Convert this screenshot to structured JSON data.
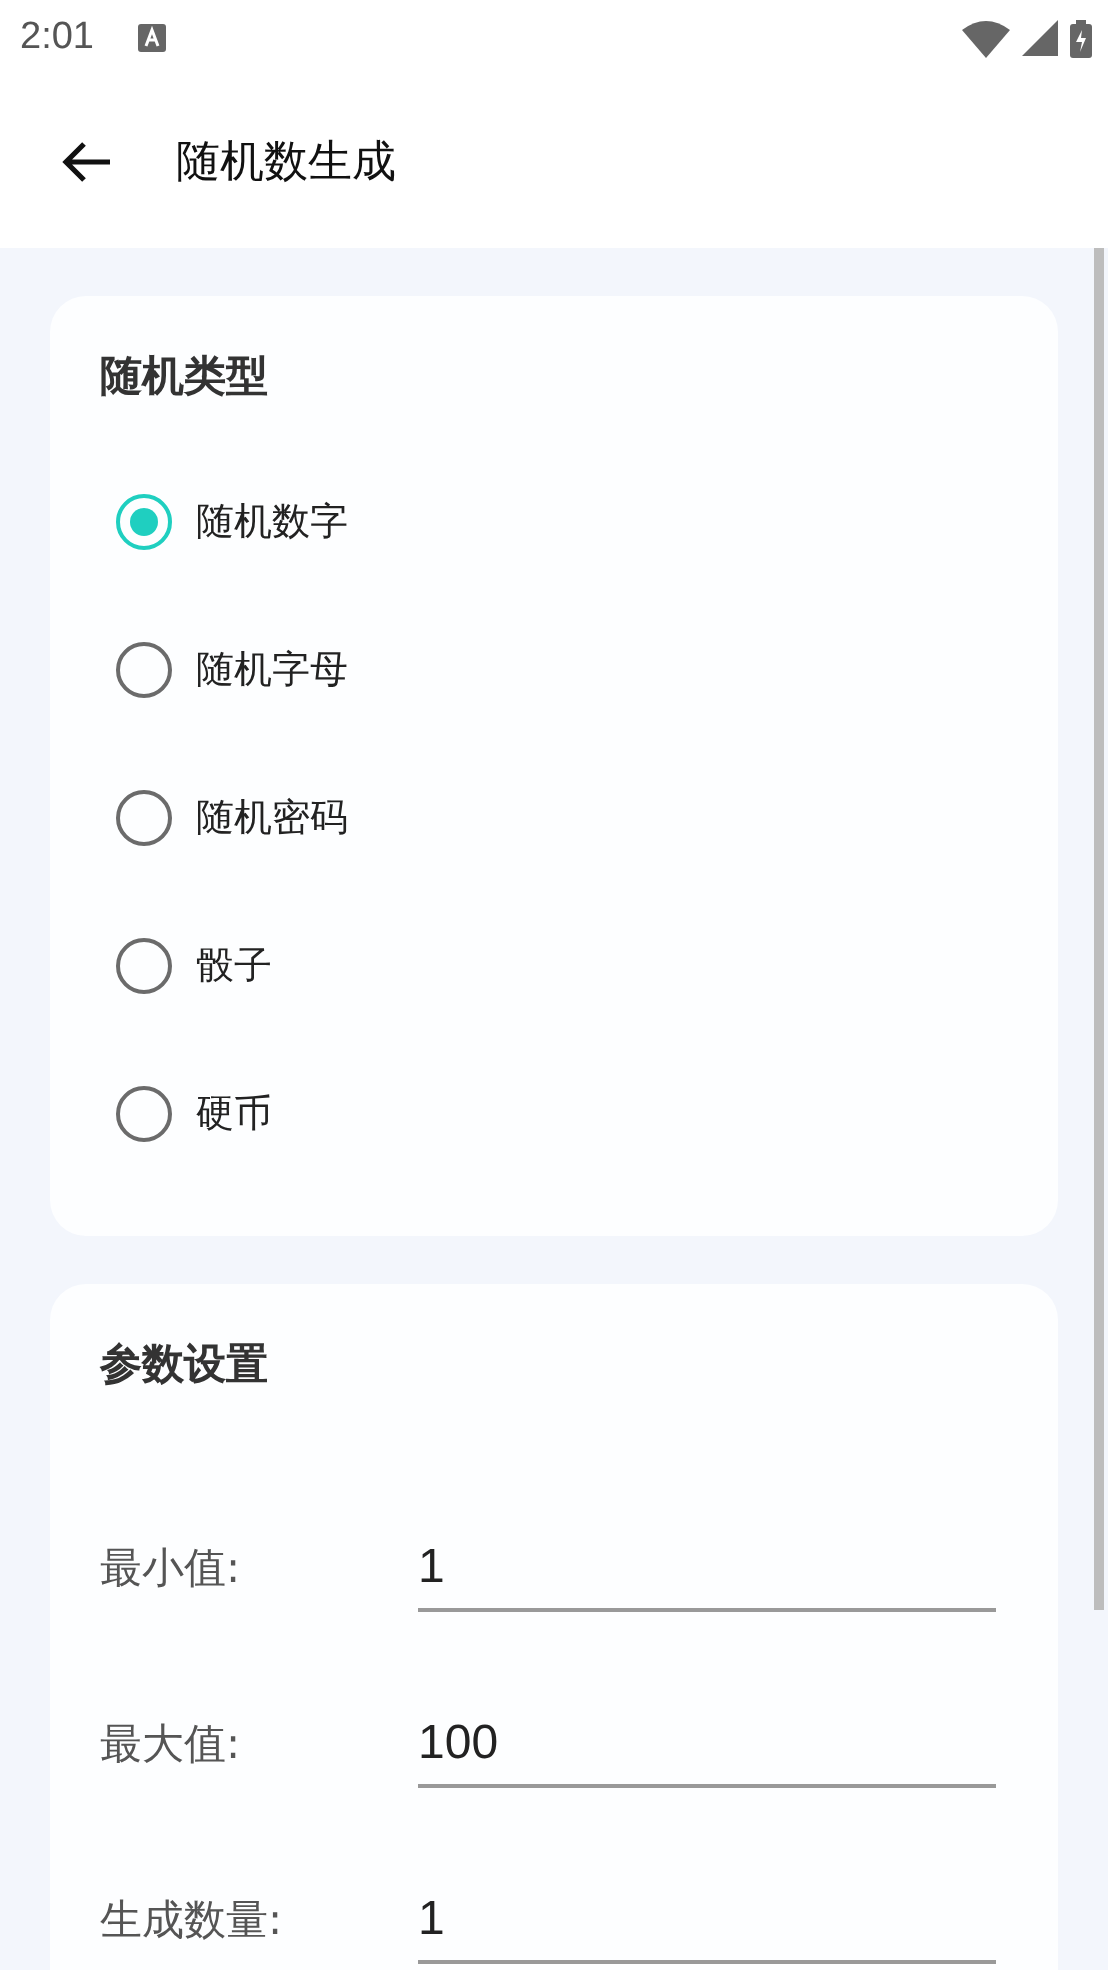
{
  "status_bar": {
    "time": "2:01"
  },
  "app_bar": {
    "title": "随机数生成"
  },
  "type_card": {
    "title": "随机类型",
    "options": [
      {
        "label": "随机数字",
        "selected": true
      },
      {
        "label": "随机字母",
        "selected": false
      },
      {
        "label": "随机密码",
        "selected": false
      },
      {
        "label": "骰子",
        "selected": false
      },
      {
        "label": "硬币",
        "selected": false
      }
    ]
  },
  "params_card": {
    "title": "参数设置",
    "fields": [
      {
        "label": "最小值:",
        "value": "1"
      },
      {
        "label": "最大值:",
        "value": "100"
      },
      {
        "label": "生成数量:",
        "value": "1"
      }
    ]
  }
}
